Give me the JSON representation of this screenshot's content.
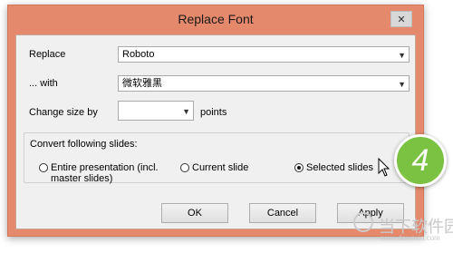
{
  "dialog": {
    "title": "Replace Font",
    "close_glyph": "✕"
  },
  "form": {
    "replace_label": "Replace",
    "replace_value": "Roboto",
    "with_label": "... with",
    "with_value": "微软雅黑",
    "size_label": "Change size by",
    "size_value": "",
    "points_label": "points"
  },
  "convert": {
    "group_label": "Convert following slides:",
    "options": [
      {
        "label_line1": "Entire presentation (incl.",
        "label_line2": "master slides)",
        "selected": false
      },
      {
        "label_line1": "Current slide",
        "label_line2": "",
        "selected": false
      },
      {
        "label_line1": "Selected slides",
        "label_line2": "",
        "selected": true
      }
    ]
  },
  "buttons": {
    "ok": "OK",
    "cancel": "Cancel",
    "apply": "Apply"
  },
  "step_badge": "4",
  "watermark": {
    "text": "当下软件园",
    "url": "www.downxia.com"
  },
  "colors": {
    "window_frame": "#e5896c",
    "client": "#f0f0f0",
    "badge": "#7cc242"
  }
}
